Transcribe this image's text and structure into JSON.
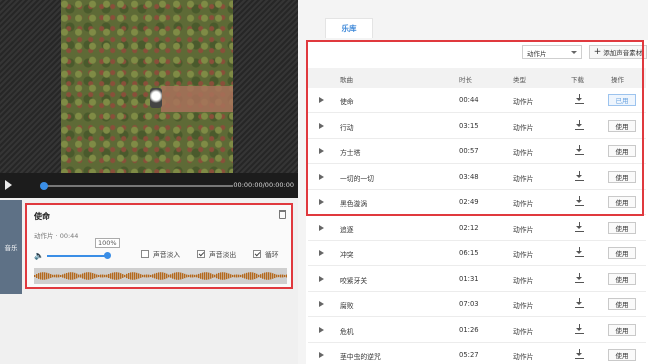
{
  "player": {
    "time": "00:00:00/00:00:00",
    "progress": 0
  },
  "music_side": {
    "label": "音乐"
  },
  "track_card": {
    "title": "使命",
    "meta": "动作片 · 00:44",
    "volume_label": "100%",
    "volume": 1.0,
    "options": [
      {
        "label": "声音淡入",
        "checked": false
      },
      {
        "label": "声音淡出",
        "checked": true
      },
      {
        "label": "循环",
        "checked": true
      }
    ]
  },
  "library": {
    "tab": "乐库",
    "category": "动作片",
    "add_label": "添加声音素材",
    "columns": {
      "title": "歌曲",
      "duration": "时长",
      "type": "类型",
      "download": "下载",
      "action": "操作"
    },
    "rows": [
      {
        "title": "使命",
        "duration": "00:44",
        "type": "动作片",
        "action": "已用",
        "used": true
      },
      {
        "title": "行动",
        "duration": "03:15",
        "type": "动作片",
        "action": "使用",
        "used": false
      },
      {
        "title": "方士塔",
        "duration": "00:57",
        "type": "动作片",
        "action": "使用",
        "used": false
      },
      {
        "title": "一切的一切",
        "duration": "03:48",
        "type": "动作片",
        "action": "使用",
        "used": false
      },
      {
        "title": "黑色漩涡",
        "duration": "02:49",
        "type": "动作片",
        "action": "使用",
        "used": false
      },
      {
        "title": "追逐",
        "duration": "02:12",
        "type": "动作片",
        "action": "使用",
        "used": false
      },
      {
        "title": "冲突",
        "duration": "06:15",
        "type": "动作片",
        "action": "使用",
        "used": false
      },
      {
        "title": "咬紧牙关",
        "duration": "01:31",
        "type": "动作片",
        "action": "使用",
        "used": false
      },
      {
        "title": "腐败",
        "duration": "07:03",
        "type": "动作片",
        "action": "使用",
        "used": false
      },
      {
        "title": "危机",
        "duration": "01:26",
        "type": "动作片",
        "action": "使用",
        "used": false
      },
      {
        "title": "茎中虫的逆咒",
        "duration": "05:27",
        "type": "动作片",
        "action": "使用",
        "used": false
      }
    ]
  },
  "colors": {
    "accent": "#3a8ee6",
    "highlight": "#e0393e",
    "waveform": "#b4681c"
  }
}
